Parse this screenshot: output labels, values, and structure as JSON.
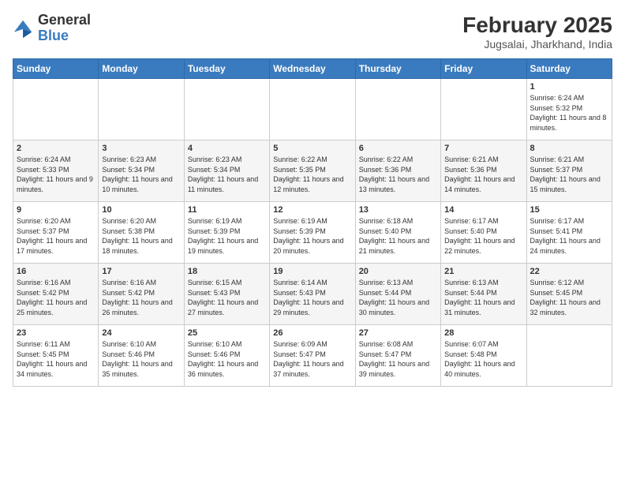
{
  "logo": {
    "line1": "General",
    "line2": "Blue"
  },
  "title": "February 2025",
  "subtitle": "Jugsalai, Jharkhand, India",
  "days_of_week": [
    "Sunday",
    "Monday",
    "Tuesday",
    "Wednesday",
    "Thursday",
    "Friday",
    "Saturday"
  ],
  "weeks": [
    [
      {
        "day": "",
        "info": ""
      },
      {
        "day": "",
        "info": ""
      },
      {
        "day": "",
        "info": ""
      },
      {
        "day": "",
        "info": ""
      },
      {
        "day": "",
        "info": ""
      },
      {
        "day": "",
        "info": ""
      },
      {
        "day": "1",
        "info": "Sunrise: 6:24 AM\nSunset: 5:32 PM\nDaylight: 11 hours and 8 minutes."
      }
    ],
    [
      {
        "day": "2",
        "info": "Sunrise: 6:24 AM\nSunset: 5:33 PM\nDaylight: 11 hours and 9 minutes."
      },
      {
        "day": "3",
        "info": "Sunrise: 6:23 AM\nSunset: 5:34 PM\nDaylight: 11 hours and 10 minutes."
      },
      {
        "day": "4",
        "info": "Sunrise: 6:23 AM\nSunset: 5:34 PM\nDaylight: 11 hours and 11 minutes."
      },
      {
        "day": "5",
        "info": "Sunrise: 6:22 AM\nSunset: 5:35 PM\nDaylight: 11 hours and 12 minutes."
      },
      {
        "day": "6",
        "info": "Sunrise: 6:22 AM\nSunset: 5:36 PM\nDaylight: 11 hours and 13 minutes."
      },
      {
        "day": "7",
        "info": "Sunrise: 6:21 AM\nSunset: 5:36 PM\nDaylight: 11 hours and 14 minutes."
      },
      {
        "day": "8",
        "info": "Sunrise: 6:21 AM\nSunset: 5:37 PM\nDaylight: 11 hours and 15 minutes."
      }
    ],
    [
      {
        "day": "9",
        "info": "Sunrise: 6:20 AM\nSunset: 5:37 PM\nDaylight: 11 hours and 17 minutes."
      },
      {
        "day": "10",
        "info": "Sunrise: 6:20 AM\nSunset: 5:38 PM\nDaylight: 11 hours and 18 minutes."
      },
      {
        "day": "11",
        "info": "Sunrise: 6:19 AM\nSunset: 5:39 PM\nDaylight: 11 hours and 19 minutes."
      },
      {
        "day": "12",
        "info": "Sunrise: 6:19 AM\nSunset: 5:39 PM\nDaylight: 11 hours and 20 minutes."
      },
      {
        "day": "13",
        "info": "Sunrise: 6:18 AM\nSunset: 5:40 PM\nDaylight: 11 hours and 21 minutes."
      },
      {
        "day": "14",
        "info": "Sunrise: 6:17 AM\nSunset: 5:40 PM\nDaylight: 11 hours and 22 minutes."
      },
      {
        "day": "15",
        "info": "Sunrise: 6:17 AM\nSunset: 5:41 PM\nDaylight: 11 hours and 24 minutes."
      }
    ],
    [
      {
        "day": "16",
        "info": "Sunrise: 6:16 AM\nSunset: 5:42 PM\nDaylight: 11 hours and 25 minutes."
      },
      {
        "day": "17",
        "info": "Sunrise: 6:16 AM\nSunset: 5:42 PM\nDaylight: 11 hours and 26 minutes."
      },
      {
        "day": "18",
        "info": "Sunrise: 6:15 AM\nSunset: 5:43 PM\nDaylight: 11 hours and 27 minutes."
      },
      {
        "day": "19",
        "info": "Sunrise: 6:14 AM\nSunset: 5:43 PM\nDaylight: 11 hours and 29 minutes."
      },
      {
        "day": "20",
        "info": "Sunrise: 6:13 AM\nSunset: 5:44 PM\nDaylight: 11 hours and 30 minutes."
      },
      {
        "day": "21",
        "info": "Sunrise: 6:13 AM\nSunset: 5:44 PM\nDaylight: 11 hours and 31 minutes."
      },
      {
        "day": "22",
        "info": "Sunrise: 6:12 AM\nSunset: 5:45 PM\nDaylight: 11 hours and 32 minutes."
      }
    ],
    [
      {
        "day": "23",
        "info": "Sunrise: 6:11 AM\nSunset: 5:45 PM\nDaylight: 11 hours and 34 minutes."
      },
      {
        "day": "24",
        "info": "Sunrise: 6:10 AM\nSunset: 5:46 PM\nDaylight: 11 hours and 35 minutes."
      },
      {
        "day": "25",
        "info": "Sunrise: 6:10 AM\nSunset: 5:46 PM\nDaylight: 11 hours and 36 minutes."
      },
      {
        "day": "26",
        "info": "Sunrise: 6:09 AM\nSunset: 5:47 PM\nDaylight: 11 hours and 37 minutes."
      },
      {
        "day": "27",
        "info": "Sunrise: 6:08 AM\nSunset: 5:47 PM\nDaylight: 11 hours and 39 minutes."
      },
      {
        "day": "28",
        "info": "Sunrise: 6:07 AM\nSunset: 5:48 PM\nDaylight: 11 hours and 40 minutes."
      },
      {
        "day": "",
        "info": ""
      }
    ]
  ]
}
